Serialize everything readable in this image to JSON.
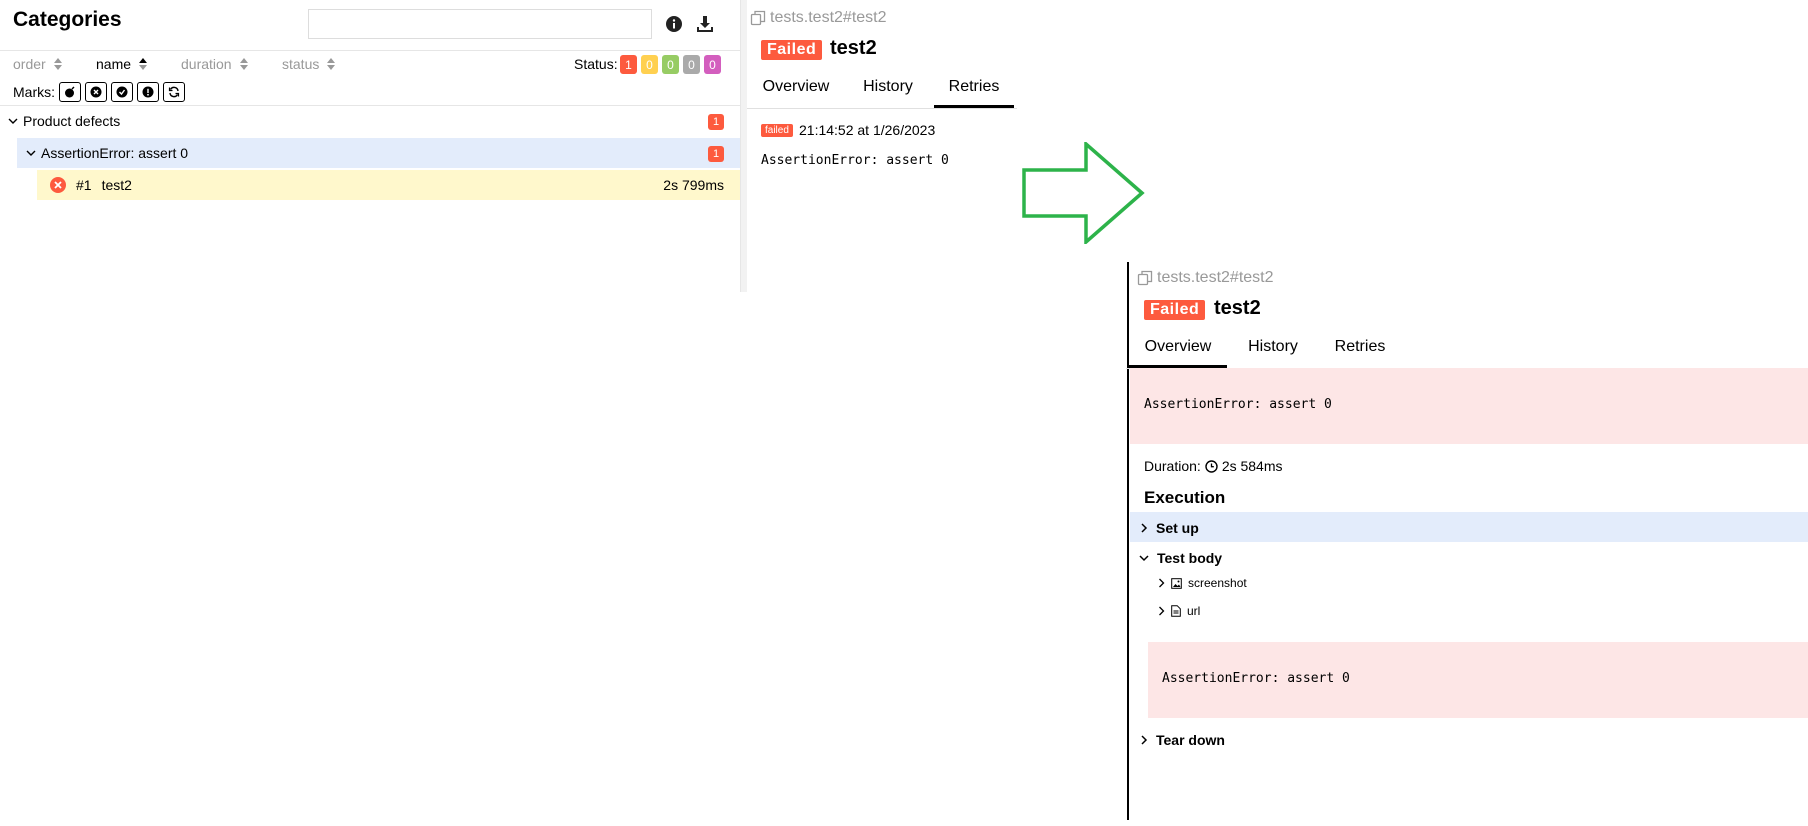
{
  "left": {
    "title": "Categories",
    "search": {
      "value": "",
      "placeholder": ""
    },
    "sort": {
      "order": "order",
      "name": "name",
      "duration": "duration",
      "status": "status"
    },
    "status_label": "Status:",
    "status_counts": [
      {
        "value": "1",
        "color": "#fd5a3e"
      },
      {
        "value": "0",
        "color": "#ffd050"
      },
      {
        "value": "0",
        "color": "#97cc64"
      },
      {
        "value": "0",
        "color": "#aaaaaa"
      },
      {
        "value": "0",
        "color": "#d35ebe"
      }
    ],
    "marks_label": "Marks:",
    "tree": {
      "group_label": "Product defects",
      "group_count": "1",
      "sub_label": "AssertionError: assert 0",
      "sub_count": "1",
      "test_order": "#1",
      "test_name": "test2",
      "test_duration": "2s 799ms"
    }
  },
  "top_detail": {
    "breadcrumb": "tests.test2#test2",
    "status_badge": "Failed",
    "title": "test2",
    "tabs": {
      "overview": "Overview",
      "history": "History",
      "retries": "Retries"
    },
    "retry_status": "failed",
    "retry_time": "21:14:52 at 1/26/2023",
    "retry_message": "AssertionError: assert 0"
  },
  "bottom_detail": {
    "breadcrumb": "tests.test2#test2",
    "status_badge": "Failed",
    "title": "test2",
    "tabs": {
      "overview": "Overview",
      "history": "History",
      "retries": "Retries"
    },
    "error_message": "AssertionError: assert 0",
    "duration_label": "Duration:",
    "duration_value": "2s 584ms",
    "execution_heading": "Execution",
    "set_up": "Set up",
    "test_body": "Test body",
    "attachments": {
      "screenshot": "screenshot",
      "url": "url"
    },
    "body_error": "AssertionError: assert 0",
    "tear_down": "Tear down"
  },
  "colors": {
    "failed": "#fd5a3e",
    "selected_row": "#fff8cc",
    "group_row": "#e3ecfb",
    "error_bg": "#fde6e6",
    "arrow": "#2db34a"
  }
}
